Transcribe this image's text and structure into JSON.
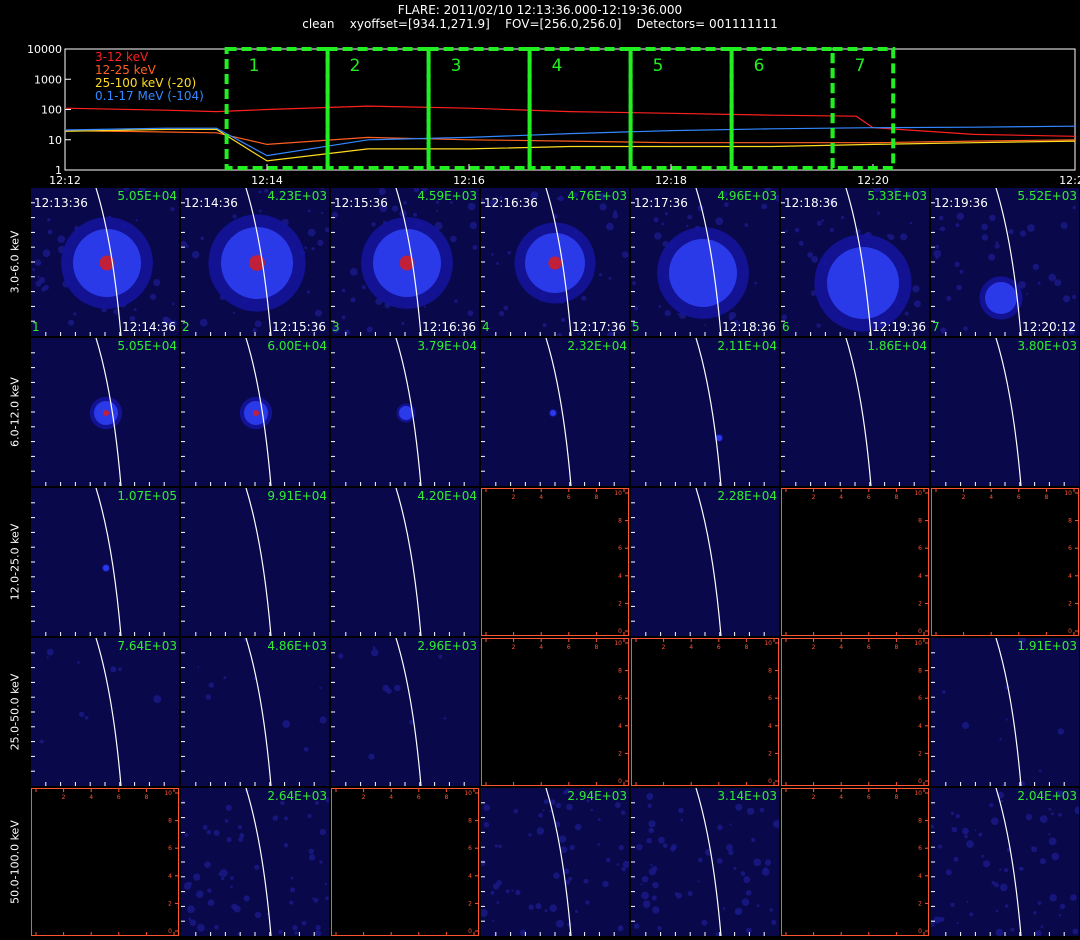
{
  "header": {
    "line1": "FLARE: 2011/02/10 12:13:36.000-12:19:36.000",
    "line2": "clean    xyoffset=[934.1,271.9]    FOV=[256.0,256.0]    Detectors= 001111111"
  },
  "lightcurve": {
    "legend": [
      {
        "label": "3-12 keV",
        "color": "#ff2020"
      },
      {
        "label": "12-25 keV",
        "color": "#ff6020"
      },
      {
        "label": "25-100 keV (-20)",
        "color": "#ffdd22"
      },
      {
        "label": "0.1-17 MeV (-104)",
        "color": "#3388ff"
      }
    ],
    "y_ticks": [
      "1",
      "10",
      "100",
      "1000",
      "10000"
    ],
    "x_ticks": [
      "12:12",
      "12:14",
      "12:16",
      "12:18",
      "12:20",
      "12:22"
    ],
    "intervals": [
      "1",
      "2",
      "3",
      "4",
      "5",
      "6",
      "7"
    ],
    "interval_color": "#22ee22"
  },
  "rows": [
    {
      "label": "3.0-6.0 keV"
    },
    {
      "label": "6.0-12.0 keV"
    },
    {
      "label": "12.0-25.0 keV"
    },
    {
      "label": "25.0-50.0 keV"
    },
    {
      "label": "50.0-100.0 keV"
    }
  ],
  "columns": [
    {
      "start": "12:13:36",
      "end": "12:14:36",
      "index": "1"
    },
    {
      "start": "12:14:36",
      "end": "12:15:36",
      "index": "2"
    },
    {
      "start": "12:15:36",
      "end": "12:16:36",
      "index": "3"
    },
    {
      "start": "12:16:36",
      "end": "12:17:36",
      "index": "4"
    },
    {
      "start": "12:17:36",
      "end": "12:18:36",
      "index": "5"
    },
    {
      "start": "12:18:36",
      "end": "12:19:36",
      "index": "6"
    },
    {
      "start": "12:19:36",
      "end": "12:20:12",
      "index": "7"
    }
  ],
  "chart_data": {
    "type": "heatmap",
    "title": "FLARE: 2011/02/10 12:13:36.000-12:19:36.000",
    "grid_max_values": [
      [
        "5.05E+04",
        "4.23E+03",
        "4.59E+03",
        "4.76E+03",
        "4.96E+03",
        "5.33E+03",
        "5.52E+03"
      ],
      [
        "5.05E+04",
        "6.00E+04",
        "3.79E+04",
        "2.32E+04",
        "2.11E+04",
        "1.86E+04",
        "3.80E+03"
      ],
      [
        "1.07E+05",
        "9.91E+04",
        "4.20E+04",
        "",
        "2.28E+04",
        "",
        ""
      ],
      [
        "7.64E+03",
        "4.86E+03",
        "2.96E+03",
        "",
        "",
        "",
        "1.91E+03"
      ],
      [
        "",
        "2.64E+03",
        "",
        "2.94E+03",
        "3.14E+03",
        "",
        "2.04E+03"
      ]
    ],
    "empty_axis_ticks": [
      "0",
      "2",
      "4",
      "6",
      "8",
      "10"
    ],
    "lightcurve_series": [
      {
        "name": "3-12 keV",
        "x": [
          "12:12",
          "12:13",
          "12:13:30",
          "12:14",
          "12:15",
          "12:16",
          "12:17",
          "12:18",
          "12:19",
          "12:19:50",
          "12:20",
          "12:21",
          "12:22"
        ],
        "y": [
          110,
          95,
          85,
          100,
          130,
          110,
          85,
          75,
          65,
          60,
          25,
          15,
          13
        ]
      },
      {
        "name": "12-25 keV",
        "x": [
          "12:12",
          "12:13",
          "12:13:30",
          "12:14",
          "12:15",
          "12:16",
          "12:17",
          "12:18",
          "12:19",
          "12:20",
          "12:21",
          "12:22"
        ],
        "y": [
          20,
          18,
          17,
          7,
          12,
          10,
          9,
          8,
          8,
          8,
          9,
          10
        ]
      },
      {
        "name": "25-100 keV (-20)",
        "x": [
          "12:12",
          "12:13",
          "12:13:30",
          "12:14",
          "12:15",
          "12:16",
          "12:17",
          "12:18",
          "12:19",
          "12:20",
          "12:21",
          "12:22"
        ],
        "y": [
          19,
          22,
          22,
          2,
          5,
          5,
          6,
          6,
          6,
          7,
          8,
          9
        ]
      },
      {
        "name": "0.1-17 MeV (-104)",
        "x": [
          "12:12",
          "12:13",
          "12:13:30",
          "12:14",
          "12:15",
          "12:16",
          "12:17",
          "12:18",
          "12:19",
          "12:20",
          "12:21",
          "12:22"
        ],
        "y": [
          21,
          24,
          24,
          3,
          10,
          12,
          16,
          20,
          23,
          25,
          26,
          28
        ]
      }
    ],
    "ylim": [
      1,
      10000
    ],
    "yscale": "log",
    "xlim": [
      "12:12",
      "12:22"
    ]
  }
}
